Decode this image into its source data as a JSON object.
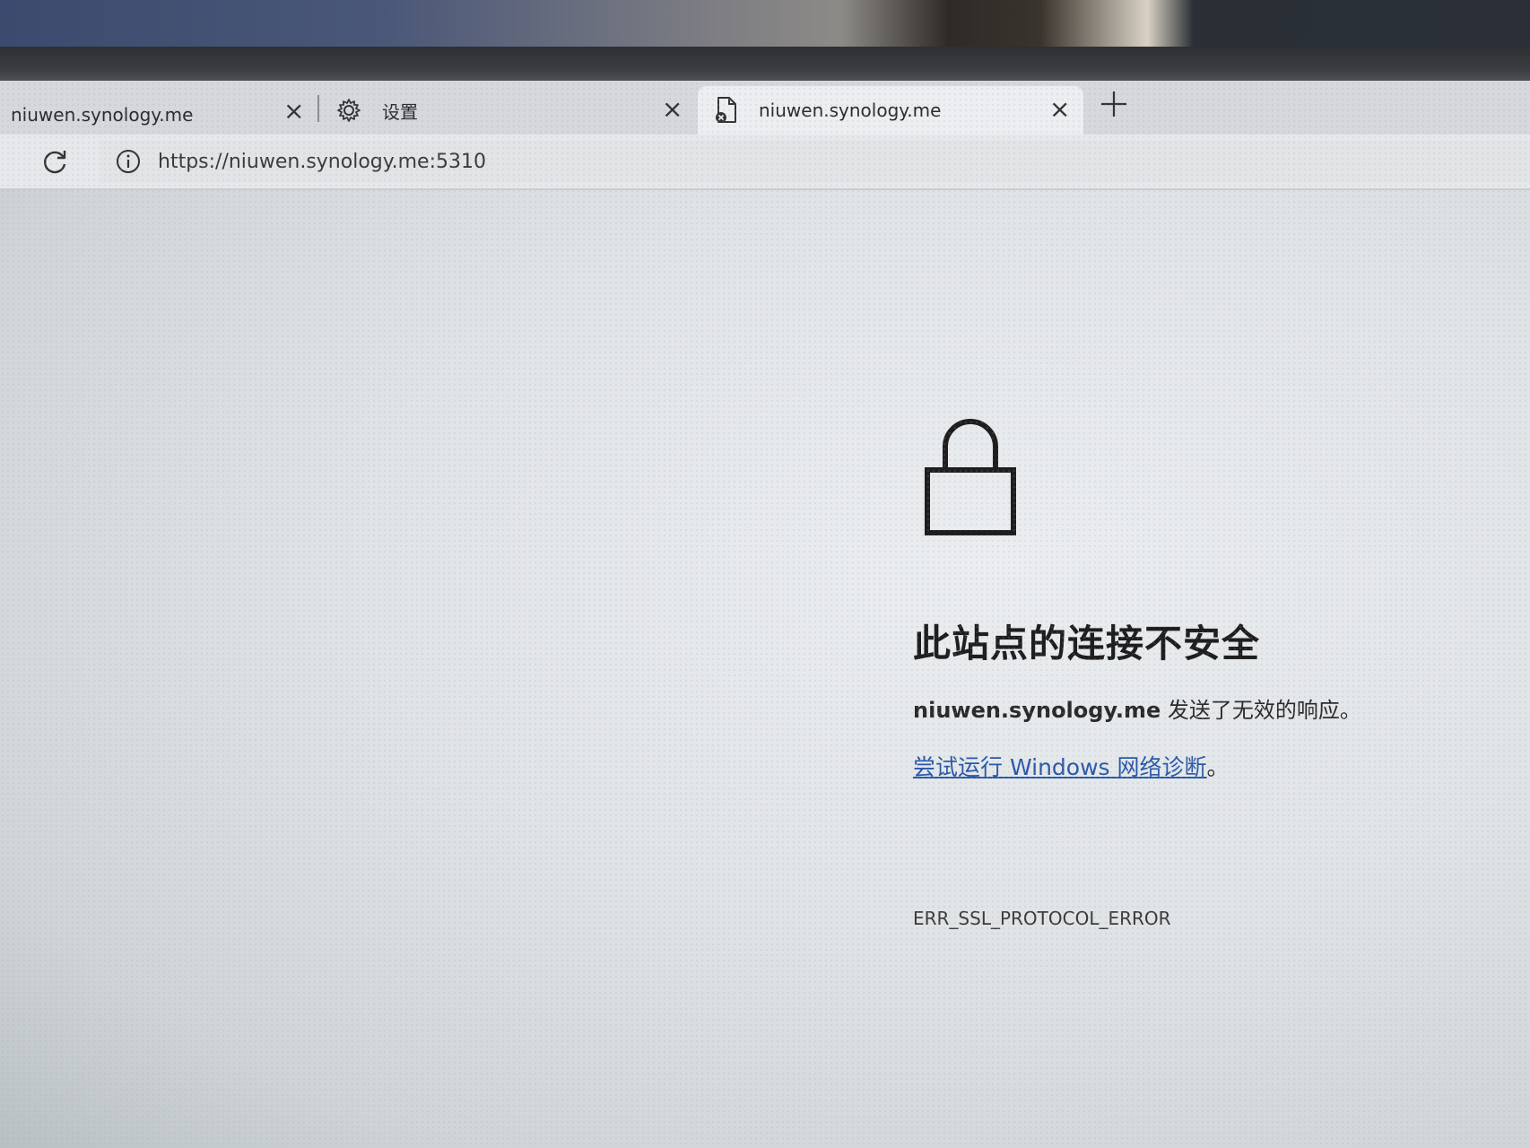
{
  "tabs": [
    {
      "label": "niuwen.synology.me",
      "icon": "none",
      "close": "×"
    },
    {
      "label": "设置",
      "icon": "gear-icon",
      "close": "×"
    },
    {
      "label": "niuwen.synology.me",
      "icon": "page-error-icon",
      "close": "×",
      "active": true
    }
  ],
  "new_tab": "+",
  "address_bar": {
    "url": "https://niuwen.synology.me:5310",
    "icon": "info-icon"
  },
  "error": {
    "icon": "unlocked-padlock-icon",
    "title": "此站点的连接不安全",
    "host": "niuwen.synology.me",
    "message": " 发送了无效的响应。",
    "link_text": "尝试运行 Windows 网络诊断",
    "link_suffix": "。",
    "code": "ERR_SSL_PROTOCOL_ERROR"
  },
  "colors": {
    "link": "#2a58a8",
    "page_bg": "#e6eaec",
    "title": "#1e1e1e"
  }
}
